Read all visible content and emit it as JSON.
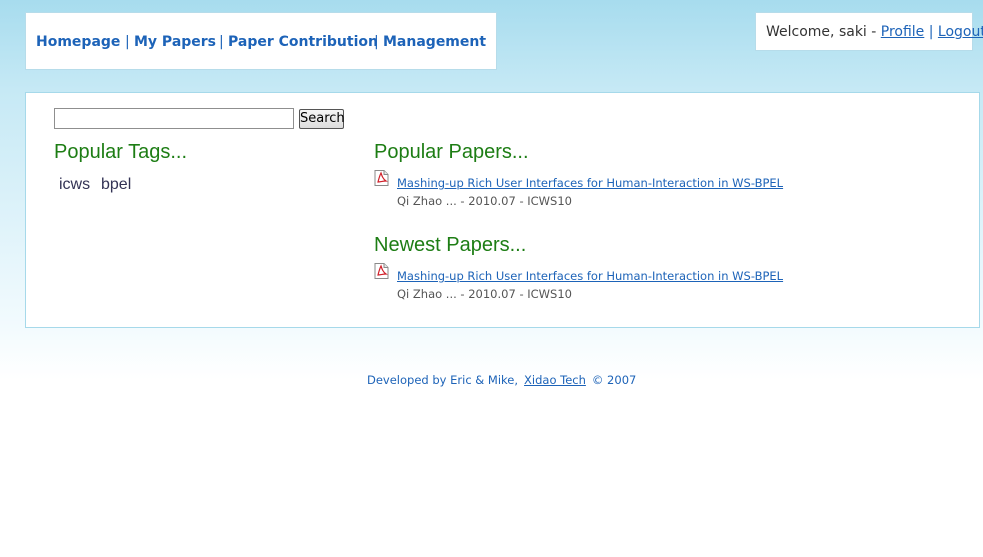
{
  "nav": {
    "items": [
      {
        "label": "Homepage"
      },
      {
        "label": "My Papers"
      },
      {
        "label": "Paper Contribution"
      },
      {
        "label": "Management"
      }
    ],
    "separator": "|"
  },
  "user": {
    "welcome": "Welcome, saki - ",
    "profile": "Profile",
    "separator": "|",
    "logout": "Logout"
  },
  "search": {
    "value": "",
    "button_label": "Search"
  },
  "tags": {
    "title": "Popular Tags...",
    "items": [
      "icws",
      "bpel"
    ]
  },
  "popular": {
    "title": "Popular Papers...",
    "papers": [
      {
        "icon": "pdf-icon",
        "title": "Mashing-up Rich User Interfaces for Human-Interaction in WS-BPEL",
        "meta": "Qi Zhao ... - 2010.07 - ICWS10"
      }
    ]
  },
  "newest": {
    "title": "Newest Papers...",
    "papers": [
      {
        "icon": "pdf-icon",
        "title": "Mashing-up Rich User Interfaces for Human-Interaction in WS-BPEL",
        "meta": "Qi Zhao ... - 2010.07 - ICWS10"
      }
    ]
  },
  "footer": {
    "developed": "Developed by Eric & Mike,",
    "link": "Xidao Tech",
    "copyright": "© 2007"
  },
  "colors": {
    "link": "#1d63b8",
    "section_title": "#1d7d14",
    "border": "#a6d9ea",
    "background_top": "#a7dcee"
  }
}
